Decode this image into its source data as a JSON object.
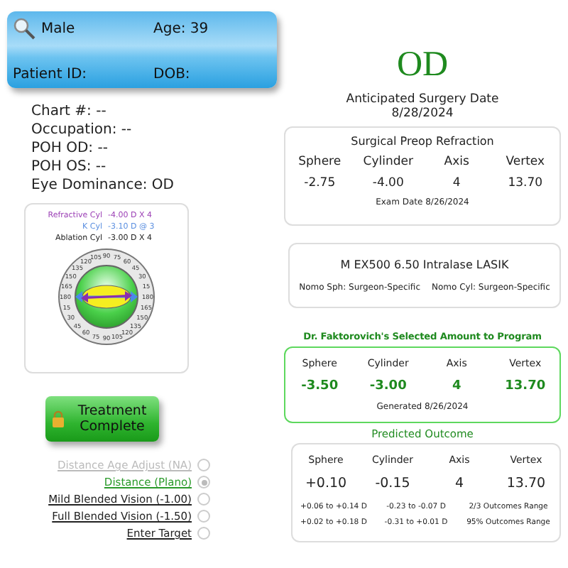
{
  "patient": {
    "sex": "Male",
    "age": "Age: 39",
    "id_label": "Patient ID:",
    "dob_label": "DOB:"
  },
  "info": [
    "Chart #: --",
    "Occupation: --",
    "POH OD: --",
    "POH OS: --",
    "Eye Dominance: OD"
  ],
  "cyl_readings": [
    {
      "label": "Refractive Cyl",
      "value": "-4.00 D X 4",
      "color": "#9b3fb5"
    },
    {
      "label": "K Cyl",
      "value": "-3.10 D @ 3",
      "color": "#5b8fe0"
    },
    {
      "label": "Ablation Cyl",
      "value": "-3.00 D X 4",
      "color": "#222222"
    }
  ],
  "dial_labels": [
    "105",
    "90",
    "75",
    "120",
    "60",
    "135",
    "45",
    "150",
    "30",
    "165",
    "15",
    "180",
    "180",
    "15",
    "165",
    "30",
    "150",
    "45",
    "135",
    "60",
    "120",
    "75",
    "90",
    "105"
  ],
  "treatment_button": {
    "label": "Treatment Complete"
  },
  "targets": [
    {
      "label": "Distance Age Adjust (NA)",
      "selected": false,
      "disabled": true
    },
    {
      "label": "Distance (Plano)",
      "selected": true,
      "disabled": false
    },
    {
      "label": "Mild Blended Vision (-1.00)",
      "selected": false,
      "disabled": false
    },
    {
      "label": "Full Blended Vision (-1.50)",
      "selected": false,
      "disabled": false
    },
    {
      "label": "Enter Target",
      "selected": false,
      "disabled": false
    }
  ],
  "eye": "OD",
  "surgery": {
    "title": "Anticipated Surgery Date",
    "date": "8/28/2024"
  },
  "preop": {
    "title": "Surgical Preop Refraction",
    "columns": [
      "Sphere",
      "Cylinder",
      "Axis",
      "Vertex"
    ],
    "values": [
      "-2.75",
      "-4.00",
      "4",
      "13.70"
    ],
    "note": "Exam Date 8/26/2024"
  },
  "laser": {
    "name": "M EX500 6.50 Intralase LASIK",
    "nomo": [
      "Nomo Sph: Surgeon-Specific",
      "Nomo Cyl: Surgeon-Specific"
    ]
  },
  "selected": {
    "title": "Dr. Faktorovich's Selected Amount to Program",
    "columns": [
      "Sphere",
      "Cylinder",
      "Axis",
      "Vertex"
    ],
    "values": [
      "-3.50",
      "-3.00",
      "4",
      "13.70"
    ],
    "note": "Generated 8/26/2024"
  },
  "outcome": {
    "title": "Predicted Outcome",
    "columns": [
      "Sphere",
      "Cylinder",
      "Axis",
      "Vertex"
    ],
    "values": [
      "+0.10",
      "-0.15",
      "4",
      "13.70"
    ],
    "ranges": [
      [
        "+0.06 to +0.14 D",
        "-0.23 to -0.07 D",
        "2/3 Outcomes Range"
      ],
      [
        "+0.02 to +0.18 D",
        "-0.31 to +0.01 D",
        "95% Outcomes Range"
      ]
    ]
  }
}
